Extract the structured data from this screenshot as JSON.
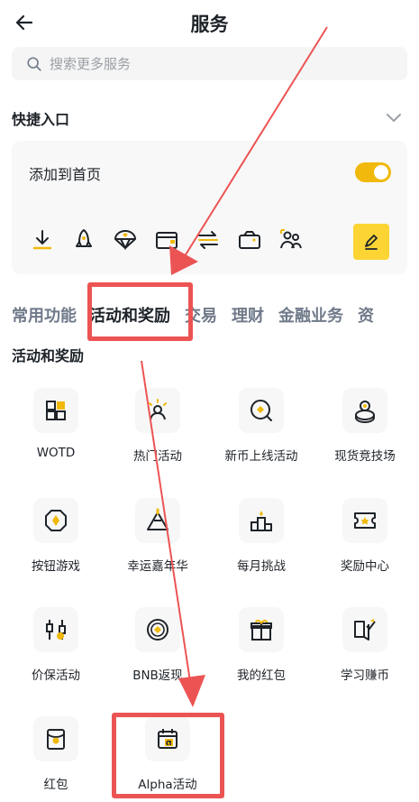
{
  "header": {
    "title": "服务",
    "back_icon": "arrow-left-icon"
  },
  "search": {
    "placeholder": "搜索更多服务",
    "value": ""
  },
  "quick_entry": {
    "title": "快捷入口",
    "add_to_home_label": "添加到首页",
    "toggle_on": true,
    "icons": [
      "download-icon",
      "rocket-icon",
      "parachute-icon",
      "wallet-icon",
      "transfer-icon",
      "gift-wallet-icon",
      "referral-users-icon"
    ],
    "edit_icon": "pencil-icon"
  },
  "tabs": [
    "常用功能",
    "活动和奖励",
    "交易",
    "理财",
    "金融业务",
    "资"
  ],
  "active_tab": "活动和奖励",
  "section_title": "活动和奖励",
  "items": [
    {
      "label": "WOTD",
      "icon": "wotd-icon"
    },
    {
      "label": "热门活动",
      "icon": "hot-activity-icon"
    },
    {
      "label": "新币上线活动",
      "icon": "new-listing-icon"
    },
    {
      "label": "现货竞技场",
      "icon": "spot-arena-icon"
    },
    {
      "label": "按钮游戏",
      "icon": "button-game-icon"
    },
    {
      "label": "幸运嘉年华",
      "icon": "lucky-carnival-icon"
    },
    {
      "label": "每月挑战",
      "icon": "monthly-challenge-icon"
    },
    {
      "label": "奖励中心",
      "icon": "reward-center-icon"
    },
    {
      "label": "价保活动",
      "icon": "price-protect-icon"
    },
    {
      "label": "BNB返现",
      "icon": "bnb-cashback-icon"
    },
    {
      "label": "我的红包",
      "icon": "my-red-packet-icon"
    },
    {
      "label": "学习赚币",
      "icon": "learn-earn-icon"
    },
    {
      "label": "红包",
      "icon": "red-packet-icon"
    },
    {
      "label": "Alpha活动",
      "icon": "alpha-activity-icon"
    }
  ],
  "colors": {
    "accent": "#f0b90b",
    "annotation": "#ec5454",
    "text": "#1e2329",
    "muted": "#707a8a"
  }
}
